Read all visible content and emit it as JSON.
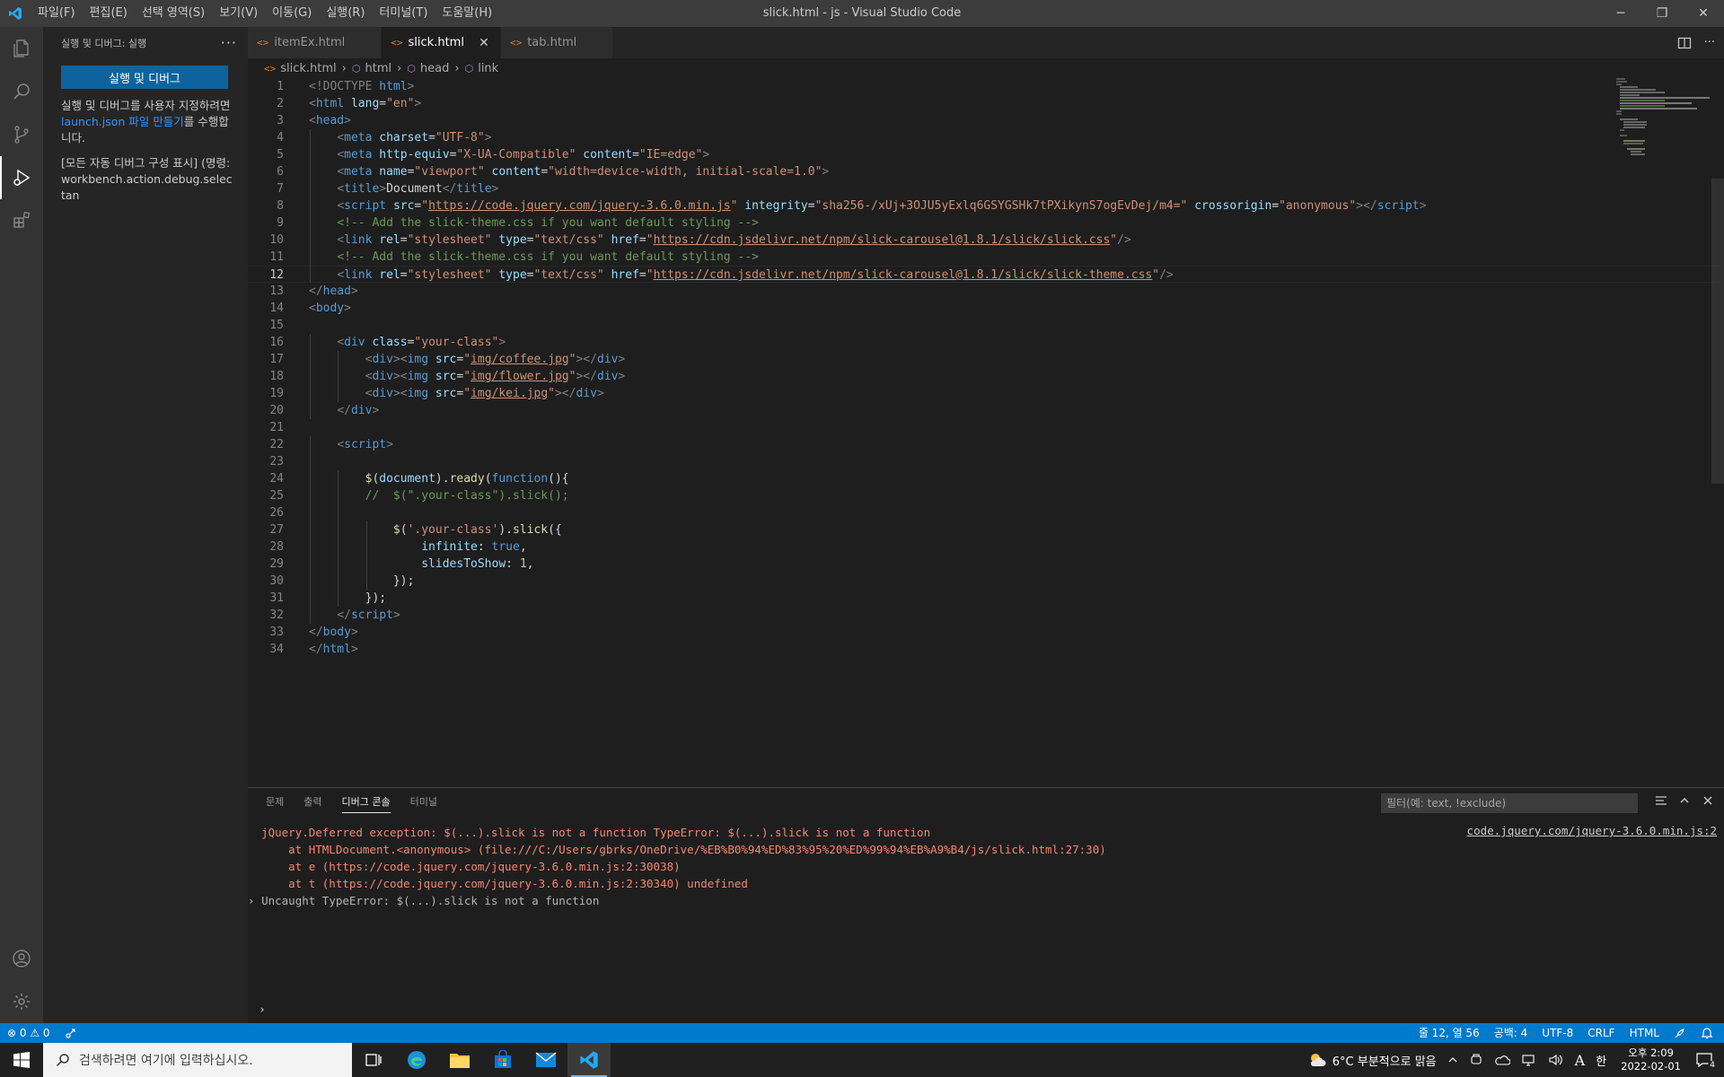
{
  "window": {
    "title": "slick.html - js - Visual Studio Code",
    "minimize": "─",
    "restore": "❐",
    "close": "✕"
  },
  "menu": [
    "파일(F)",
    "편집(E)",
    "선택 영역(S)",
    "보기(V)",
    "이동(G)",
    "실행(R)",
    "터미널(T)",
    "도움말(H)"
  ],
  "sidebar": {
    "header": "실행 및 디버그: 실행",
    "more": "···",
    "run_button": "실행 및 디버그",
    "desc_part1": "실행 및 디버그를 사용자 지정하려면 ",
    "desc_link": "launch.json 파일 만들기",
    "desc_part2": "를 수행합니다.",
    "show_all": "[모든 자동 디버그 구성 표시] (명령:workbench.action.debug.selectan"
  },
  "tabs": [
    {
      "label": "itemEx.html",
      "active": false
    },
    {
      "label": "slick.html",
      "active": true,
      "close": "✕"
    },
    {
      "label": "tab.html",
      "active": false
    }
  ],
  "tab_icon": "<>",
  "breadcrumb": [
    "slick.html",
    "html",
    "head",
    "link"
  ],
  "editor": {
    "current_line": 12,
    "line_numbers": [
      "1",
      "2",
      "3",
      "4",
      "5",
      "6",
      "7",
      "8",
      "9",
      "10",
      "11",
      "12",
      "13",
      "14",
      "15",
      "16",
      "17",
      "18",
      "19",
      "20",
      "21",
      "22",
      "23",
      "24",
      "25",
      "26",
      "27",
      "28",
      "29",
      "30",
      "31",
      "32",
      "33",
      "34"
    ],
    "lines": [
      [
        [
          "t-tag",
          "<!DOCTYPE "
        ],
        [
          "t-name",
          "html"
        ],
        [
          "t-tag",
          ">"
        ]
      ],
      [
        [
          "t-tag",
          "<"
        ],
        [
          "t-name",
          "html"
        ],
        [
          "t-txt",
          " "
        ],
        [
          "t-attr",
          "lang"
        ],
        [
          "t-txt",
          "="
        ],
        [
          "t-str",
          "\"en\""
        ],
        [
          "t-tag",
          ">"
        ]
      ],
      [
        [
          "t-tag",
          "<"
        ],
        [
          "t-name",
          "head"
        ],
        [
          "t-tag",
          ">"
        ]
      ],
      [
        [
          "t-txt",
          "    "
        ],
        [
          "t-tag",
          "<"
        ],
        [
          "t-name",
          "meta"
        ],
        [
          "t-txt",
          " "
        ],
        [
          "t-attr",
          "charset"
        ],
        [
          "t-txt",
          "="
        ],
        [
          "t-str",
          "\"UTF-8\""
        ],
        [
          "t-tag",
          ">"
        ]
      ],
      [
        [
          "t-txt",
          "    "
        ],
        [
          "t-tag",
          "<"
        ],
        [
          "t-name",
          "meta"
        ],
        [
          "t-txt",
          " "
        ],
        [
          "t-attr",
          "http-equiv"
        ],
        [
          "t-txt",
          "="
        ],
        [
          "t-str",
          "\"X-UA-Compatible\""
        ],
        [
          "t-txt",
          " "
        ],
        [
          "t-attr",
          "content"
        ],
        [
          "t-txt",
          "="
        ],
        [
          "t-str",
          "\"IE=edge\""
        ],
        [
          "t-tag",
          ">"
        ]
      ],
      [
        [
          "t-txt",
          "    "
        ],
        [
          "t-tag",
          "<"
        ],
        [
          "t-name",
          "meta"
        ],
        [
          "t-txt",
          " "
        ],
        [
          "t-attr",
          "name"
        ],
        [
          "t-txt",
          "="
        ],
        [
          "t-str",
          "\"viewport\""
        ],
        [
          "t-txt",
          " "
        ],
        [
          "t-attr",
          "content"
        ],
        [
          "t-txt",
          "="
        ],
        [
          "t-str",
          "\"width=device-width, initial-scale=1.0\""
        ],
        [
          "t-tag",
          ">"
        ]
      ],
      [
        [
          "t-txt",
          "    "
        ],
        [
          "t-tag",
          "<"
        ],
        [
          "t-name",
          "title"
        ],
        [
          "t-tag",
          ">"
        ],
        [
          "t-txt",
          "Document"
        ],
        [
          "t-tag",
          "</"
        ],
        [
          "t-name",
          "title"
        ],
        [
          "t-tag",
          ">"
        ]
      ],
      [
        [
          "t-txt",
          "    "
        ],
        [
          "t-tag",
          "<"
        ],
        [
          "t-name",
          "script"
        ],
        [
          "t-txt",
          " "
        ],
        [
          "t-attr",
          "src"
        ],
        [
          "t-txt",
          "="
        ],
        [
          "t-str",
          "\""
        ],
        [
          "t-link",
          "https://code.jquery.com/jquery-3.6.0.min.js"
        ],
        [
          "t-str",
          "\""
        ],
        [
          "t-txt",
          " "
        ],
        [
          "t-attr",
          "integrity"
        ],
        [
          "t-txt",
          "="
        ],
        [
          "t-str",
          "\"sha256-/xUj+3OJU5yExlq6GSYGSHk7tPXikynS7ogEvDej/m4=\""
        ],
        [
          "t-txt",
          " "
        ],
        [
          "t-attr",
          "crossorigin"
        ],
        [
          "t-txt",
          "="
        ],
        [
          "t-str",
          "\"anonymous\""
        ],
        [
          "t-tag",
          "></"
        ],
        [
          "t-name",
          "script"
        ],
        [
          "t-tag",
          ">"
        ]
      ],
      [
        [
          "t-txt",
          "    "
        ],
        [
          "t-cmt",
          "<!-- Add the slick-theme.css if you want default styling -->"
        ]
      ],
      [
        [
          "t-txt",
          "    "
        ],
        [
          "t-tag",
          "<"
        ],
        [
          "t-name",
          "link"
        ],
        [
          "t-txt",
          " "
        ],
        [
          "t-attr",
          "rel"
        ],
        [
          "t-txt",
          "="
        ],
        [
          "t-str",
          "\"stylesheet\""
        ],
        [
          "t-txt",
          " "
        ],
        [
          "t-attr",
          "type"
        ],
        [
          "t-txt",
          "="
        ],
        [
          "t-str",
          "\"text/css\""
        ],
        [
          "t-txt",
          " "
        ],
        [
          "t-attr",
          "href"
        ],
        [
          "t-txt",
          "="
        ],
        [
          "t-str",
          "\""
        ],
        [
          "t-link",
          "https://cdn.jsdelivr.net/npm/slick-carousel@1.8.1/slick/slick.css"
        ],
        [
          "t-str",
          "\""
        ],
        [
          "t-tag",
          "/>"
        ]
      ],
      [
        [
          "t-txt",
          "    "
        ],
        [
          "t-cmt",
          "<!-- Add the slick-theme.css if you want default styling -->"
        ]
      ],
      [
        [
          "t-txt",
          "    "
        ],
        [
          "t-tag",
          "<"
        ],
        [
          "t-name",
          "link"
        ],
        [
          "t-txt",
          " "
        ],
        [
          "t-attr",
          "rel"
        ],
        [
          "t-txt",
          "="
        ],
        [
          "t-str",
          "\"stylesheet\""
        ],
        [
          "t-txt",
          " "
        ],
        [
          "t-attr",
          "type"
        ],
        [
          "t-txt",
          "="
        ],
        [
          "t-str",
          "\"text/css\""
        ],
        [
          "t-txt",
          " "
        ],
        [
          "t-attr",
          "href"
        ],
        [
          "t-txt",
          "="
        ],
        [
          "t-str",
          "\""
        ],
        [
          "t-link",
          "https://cdn.jsdelivr.net/npm/slick-carousel@1.8.1/slick/slick-theme.css"
        ],
        [
          "t-str",
          "\""
        ],
        [
          "t-tag",
          "/>"
        ]
      ],
      [
        [
          "t-tag",
          "</"
        ],
        [
          "t-name",
          "head"
        ],
        [
          "t-tag",
          ">"
        ]
      ],
      [
        [
          "t-tag",
          "<"
        ],
        [
          "t-name",
          "body"
        ],
        [
          "t-tag",
          ">"
        ]
      ],
      [],
      [
        [
          "t-txt",
          "    "
        ],
        [
          "t-tag",
          "<"
        ],
        [
          "t-name",
          "div"
        ],
        [
          "t-txt",
          " "
        ],
        [
          "t-attr",
          "class"
        ],
        [
          "t-txt",
          "="
        ],
        [
          "t-str",
          "\"your-class\""
        ],
        [
          "t-tag",
          ">"
        ]
      ],
      [
        [
          "t-txt",
          "        "
        ],
        [
          "t-tag",
          "<"
        ],
        [
          "t-name",
          "div"
        ],
        [
          "t-tag",
          "><"
        ],
        [
          "t-name",
          "img"
        ],
        [
          "t-txt",
          " "
        ],
        [
          "t-attr",
          "src"
        ],
        [
          "t-txt",
          "="
        ],
        [
          "t-str",
          "\""
        ],
        [
          "t-link",
          "img/coffee.jpg"
        ],
        [
          "t-str",
          "\""
        ],
        [
          "t-tag",
          "></"
        ],
        [
          "t-name",
          "div"
        ],
        [
          "t-tag",
          ">"
        ]
      ],
      [
        [
          "t-txt",
          "        "
        ],
        [
          "t-tag",
          "<"
        ],
        [
          "t-name",
          "div"
        ],
        [
          "t-tag",
          "><"
        ],
        [
          "t-name",
          "img"
        ],
        [
          "t-txt",
          " "
        ],
        [
          "t-attr",
          "src"
        ],
        [
          "t-txt",
          "="
        ],
        [
          "t-str",
          "\""
        ],
        [
          "t-link",
          "img/flower.jpg"
        ],
        [
          "t-str",
          "\""
        ],
        [
          "t-tag",
          "></"
        ],
        [
          "t-name",
          "div"
        ],
        [
          "t-tag",
          ">"
        ]
      ],
      [
        [
          "t-txt",
          "        "
        ],
        [
          "t-tag",
          "<"
        ],
        [
          "t-name",
          "div"
        ],
        [
          "t-tag",
          "><"
        ],
        [
          "t-name",
          "img"
        ],
        [
          "t-txt",
          " "
        ],
        [
          "t-attr",
          "src"
        ],
        [
          "t-txt",
          "="
        ],
        [
          "t-str",
          "\""
        ],
        [
          "t-link",
          "img/kei.jpg"
        ],
        [
          "t-str",
          "\""
        ],
        [
          "t-tag",
          "></"
        ],
        [
          "t-name",
          "div"
        ],
        [
          "t-tag",
          ">"
        ]
      ],
      [
        [
          "t-txt",
          "    "
        ],
        [
          "t-tag",
          "</"
        ],
        [
          "t-name",
          "div"
        ],
        [
          "t-tag",
          ">"
        ]
      ],
      [],
      [
        [
          "t-txt",
          "    "
        ],
        [
          "t-tag",
          "<"
        ],
        [
          "t-name",
          "script"
        ],
        [
          "t-tag",
          ">"
        ]
      ],
      [],
      [
        [
          "t-txt",
          "        "
        ],
        [
          "t-fn",
          "$"
        ],
        [
          "t-txt",
          "("
        ],
        [
          "t-prop",
          "document"
        ],
        [
          "t-txt",
          ")."
        ],
        [
          "t-fn",
          "ready"
        ],
        [
          "t-txt",
          "("
        ],
        [
          "t-kw",
          "function"
        ],
        [
          "t-txt",
          "(){"
        ]
      ],
      [
        [
          "t-txt",
          "        "
        ],
        [
          "t-cmt",
          "//  $(\".your-class\").slick();"
        ]
      ],
      [],
      [
        [
          "t-txt",
          "            "
        ],
        [
          "t-fn",
          "$"
        ],
        [
          "t-txt",
          "("
        ],
        [
          "t-str",
          "'.your-class'"
        ],
        [
          "t-txt",
          ")."
        ],
        [
          "t-fn",
          "slick"
        ],
        [
          "t-txt",
          "({"
        ]
      ],
      [
        [
          "t-txt",
          "                "
        ],
        [
          "t-prop",
          "infinite"
        ],
        [
          "t-txt",
          ": "
        ],
        [
          "t-bool",
          "true"
        ],
        [
          "t-txt",
          ","
        ]
      ],
      [
        [
          "t-txt",
          "                "
        ],
        [
          "t-prop",
          "slidesToShow"
        ],
        [
          "t-txt",
          ": "
        ],
        [
          "t-num",
          "1"
        ],
        [
          "t-txt",
          ","
        ]
      ],
      [
        [
          "t-txt",
          "            });"
        ]
      ],
      [
        [
          "t-txt",
          "        });"
        ]
      ],
      [
        [
          "t-txt",
          "    "
        ],
        [
          "t-tag",
          "</"
        ],
        [
          "t-name",
          "script"
        ],
        [
          "t-tag",
          ">"
        ]
      ],
      [
        [
          "t-tag",
          "</"
        ],
        [
          "t-name",
          "body"
        ],
        [
          "t-tag",
          ">"
        ]
      ],
      [
        [
          "t-tag",
          "</"
        ],
        [
          "t-name",
          "html"
        ],
        [
          "t-tag",
          ">"
        ]
      ]
    ]
  },
  "panel": {
    "tabs": [
      {
        "label": "문제",
        "active": false
      },
      {
        "label": "출력",
        "active": false
      },
      {
        "label": "디버그 콘솔",
        "active": true
      },
      {
        "label": "터미널",
        "active": false
      }
    ],
    "filter_placeholder": "필터(예: text, !exclude)",
    "console_lines": [
      "  jQuery.Deferred exception: $(...).slick is not a function TypeError: $(...).slick is not a function",
      "      at HTMLDocument.<anonymous> (file:///C:/Users/gbrks/OneDrive/%EB%B0%94%ED%83%95%20%ED%99%94%EB%A9%B4/js/slick.html:27:30)",
      "      at e (https://code.jquery.com/jquery-3.6.0.min.js:2:30038)",
      "      at t (https://code.jquery.com/jquery-3.6.0.min.js:2:30340) undefined"
    ],
    "uncaught": "Uncaught TypeError: $(...).slick is not a function",
    "source_link": "code.jquery.com/jquery-3.6.0.min.js:2",
    "prompt": "›"
  },
  "statusbar": {
    "errors": "⊗ 0",
    "warnings": "⚠ 0",
    "position": "줄 12, 열 56",
    "spaces": "공백: 4",
    "encoding": "UTF-8",
    "eol": "CRLF",
    "language": "HTML"
  },
  "taskbar": {
    "search_placeholder": "검색하려면 여기에 입력하십시오.",
    "weather": "6°C  부분적으로 맑음",
    "ime": "한",
    "ime_mode": "A",
    "time": "오후 2:09",
    "date": "2022-02-01",
    "notifications": "4"
  },
  "colors": {
    "accent": "#007acc",
    "button": "#0e639c",
    "error": "#f48771"
  }
}
